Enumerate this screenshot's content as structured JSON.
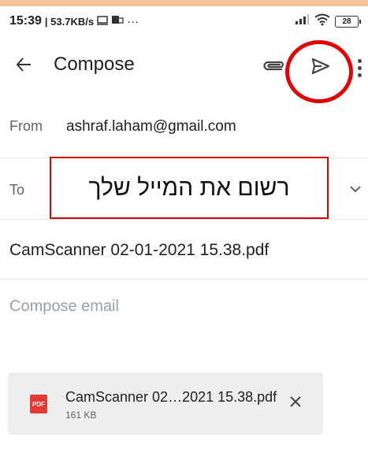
{
  "status_bar": {
    "time": "15:39",
    "speed": "| 53.7KB/s",
    "dots": "···",
    "battery": "28"
  },
  "app_bar": {
    "title": "Compose",
    "back_icon": "arrow-left-icon",
    "attach_icon": "paperclip-icon",
    "send_icon": "send-icon",
    "more_icon": "more-vert-icon"
  },
  "from": {
    "label": "From",
    "value": "ashraf.laham@gmail.com"
  },
  "to": {
    "label": "To",
    "annotation": "רשום את המייל שלך",
    "expand_icon": "chevron-down-icon"
  },
  "subject": {
    "value": "CamScanner 02-01-2021 15.38.pdf"
  },
  "body": {
    "placeholder": "Compose email"
  },
  "attachment": {
    "type_badge": "PDF",
    "name": "CamScanner 02…2021 15.38.pdf",
    "size": "161 KB",
    "remove_icon": "close-icon"
  },
  "colors": {
    "annotation_red": "#e00000",
    "pdf_red": "#e53935",
    "top_strip": "#f4c29a"
  }
}
